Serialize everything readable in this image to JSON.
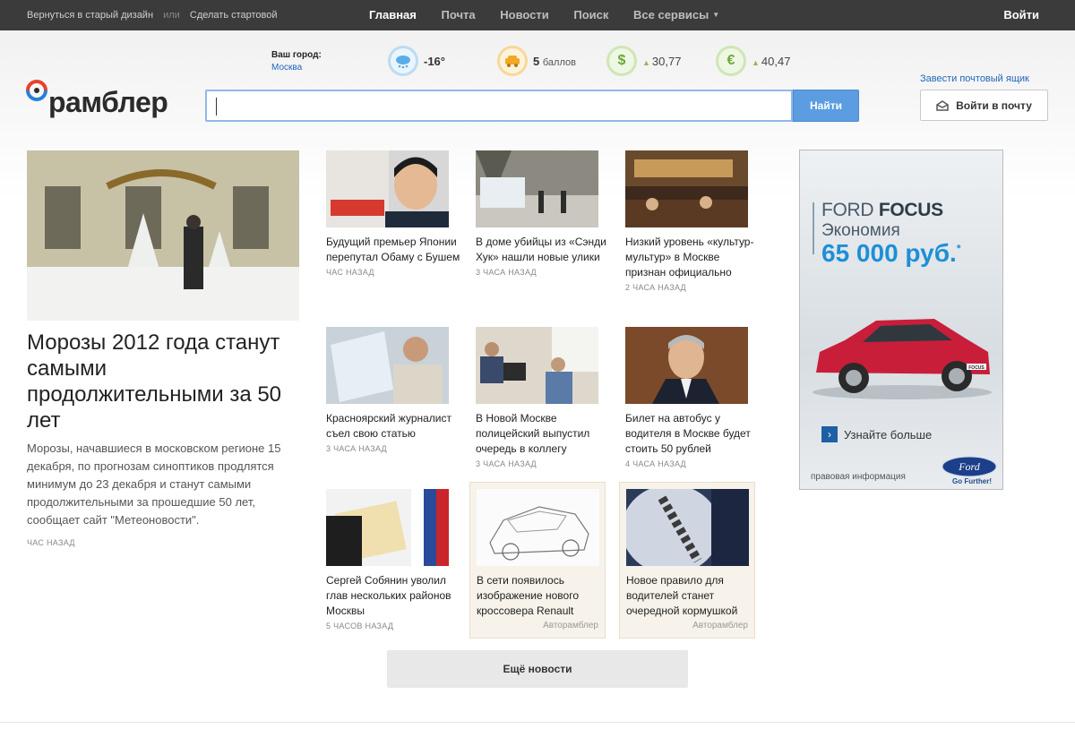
{
  "topbar": {
    "old_design": "Вернуться в старый дизайн",
    "or": "или",
    "make_start": "Сделать стартовой",
    "nav": [
      "Главная",
      "Почта",
      "Новости",
      "Поиск",
      "Все сервисы"
    ],
    "login": "Войти"
  },
  "logo": {
    "text": "рамблер"
  },
  "city": {
    "label": "Ваш город:",
    "value": "Москва"
  },
  "widgets": {
    "weather": "-16°",
    "traffic_value": "5",
    "traffic_unit": "баллов",
    "usd": "30,77",
    "eur": "40,47"
  },
  "search": {
    "button": "Найти"
  },
  "mail": {
    "create_link": "Завести почтовый ящик",
    "login_button": "Войти в почту"
  },
  "lead": {
    "title": "Морозы 2012 года станут самыми продолжительными за 50 лет",
    "text": "Морозы, начавшиеся в московском регионе 15 декабря, по прогнозам синоптиков продлятся минимум до 23 декабря и станут самыми продолжительными за прошедшие 50 лет, сообщает сайт \"Метеоновости\".",
    "time": "ЧАС НАЗАД"
  },
  "news": [
    {
      "title": "Будущий премьер Японии перепутал Обаму с Бушем",
      "time": "ЧАС НАЗАД"
    },
    {
      "title": "В доме убийцы из «Сэнди Хук» нашли новые улики",
      "time": "3 ЧАСА НАЗАД"
    },
    {
      "title": "Низкий уровень «культур-мультур» в Москве признан официально",
      "time": "2 ЧАСА НАЗАД"
    },
    {
      "title": "Красноярский журналист съел свою статью",
      "time": "3 ЧАСА НАЗАД"
    },
    {
      "title": "В Новой Москве полицейский выпустил очередь в коллегу",
      "time": "3 ЧАСА НАЗАД"
    },
    {
      "title": "Билет на автобус у водителя в Москве будет стоить 50 рублей",
      "time": "4 ЧАСА НАЗАД"
    },
    {
      "title": "Сергей Собянин уволил глав нескольких районов Москвы",
      "time": "5 ЧАСОВ НАЗАД"
    }
  ],
  "promos": [
    {
      "title": "В сети появилось изображение нового кроссовера Renault",
      "source": "Авторамблер"
    },
    {
      "title": "Новое правило для водителей станет очередной кормушкой",
      "source": "Авторамблер"
    }
  ],
  "more_button": "Ещё новости",
  "ad": {
    "line1_a": "FORD",
    "line1_b": "FOCUS",
    "line2": "Экономия",
    "line3": "65 000 руб.",
    "more": "Узнайте больше",
    "legal": "правовая информация",
    "brand": "Ford",
    "slogan": "Go Further!",
    "plate": "FOCUS"
  },
  "colors": {
    "topbar": "#3b3b3b",
    "link": "#2266bb",
    "search_button": "#5b9de0",
    "ad_price": "#1e8fd6"
  }
}
